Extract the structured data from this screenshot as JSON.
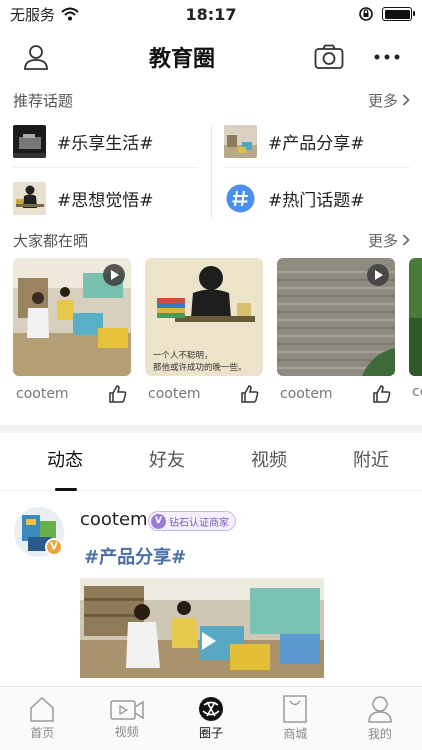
{
  "status_bar": {
    "carrier": "无服务",
    "time": "18:17"
  },
  "header": {
    "title": "教育圈"
  },
  "topics_section": {
    "heading": "推荐话题",
    "more": "更多",
    "items": [
      {
        "label": "#乐享生活#",
        "thumb": "film-thumb"
      },
      {
        "label": "#产品分享#",
        "thumb": "classroom-thumb"
      },
      {
        "label": "#思想觉悟#",
        "thumb": "person-thumb"
      },
      {
        "label": "#热门话题#",
        "icon": "hash-icon"
      }
    ]
  },
  "feed_section": {
    "heading": "大家都在晒",
    "more": "更多",
    "cards": [
      {
        "user": "cootem",
        "has_play": true
      },
      {
        "user": "cootem",
        "has_play": false,
        "caption": "一个人不聪明，\n那他或许成功的晚一些。"
      },
      {
        "user": "cootem",
        "has_play": true
      },
      {
        "user": "co",
        "has_play": false
      }
    ]
  },
  "tabs": [
    {
      "label": "动态",
      "active": true
    },
    {
      "label": "好友",
      "active": false
    },
    {
      "label": "视频",
      "active": false
    },
    {
      "label": "附近",
      "active": false
    }
  ],
  "post": {
    "author": "cootem",
    "badge": "钻石认证商家",
    "badge_v": "V",
    "avatar_v": "V",
    "topic": "#产品分享#"
  },
  "bottom_nav": [
    {
      "label": "首页",
      "icon": "home-icon",
      "active": false
    },
    {
      "label": "视频",
      "icon": "video-icon",
      "active": false
    },
    {
      "label": "圈子",
      "icon": "circle-icon",
      "active": true
    },
    {
      "label": "商城",
      "icon": "bag-icon",
      "active": false
    },
    {
      "label": "我的",
      "icon": "user-icon",
      "active": false
    }
  ],
  "colors": {
    "accent_blue": "#4a6ea8",
    "badge_purple": "#7a58c0",
    "badge_orange": "#f0a43a",
    "hash_blue": "#4a8ef0"
  }
}
